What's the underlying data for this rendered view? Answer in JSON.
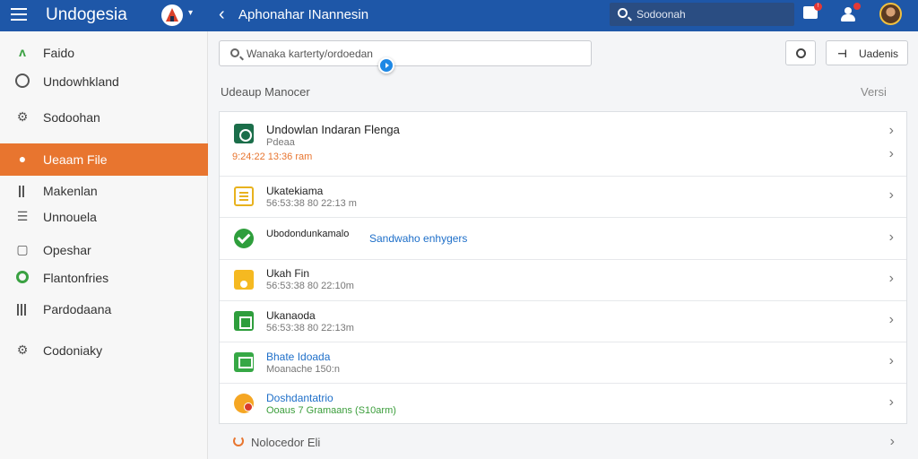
{
  "topbar": {
    "app_title": "Undogesia",
    "logo_caret": "▾",
    "back_arrow": "‹",
    "page_heading": "Aphonahar INannesin",
    "search_placeholder": "Sodoonah",
    "notification_badge": "!"
  },
  "sidebar": {
    "items": [
      {
        "label": "Faido",
        "icon": "a-icon",
        "active": false
      },
      {
        "label": "Undowhkland",
        "icon": "clock-icon",
        "active": false
      },
      {
        "label": "Sodoohan",
        "icon": "gear-icon",
        "active": false
      },
      {
        "label": "Ueaam File",
        "icon": "circle-icon",
        "active": true
      },
      {
        "label": "Makenlan",
        "icon": "bars-icon",
        "active": false
      },
      {
        "label": "Unnouela",
        "icon": "stack-icon",
        "active": false
      },
      {
        "label": "Opeshar",
        "icon": "box-icon",
        "active": false
      },
      {
        "label": "Flantonfries",
        "icon": "ring-icon",
        "active": false
      },
      {
        "label": "Pardodaana",
        "icon": "columns-icon",
        "active": false
      },
      {
        "label": "Codoniaky",
        "icon": "gear-icon",
        "active": false
      }
    ]
  },
  "main": {
    "search_value": "Wanaka karterty/ordoedan",
    "update_label": "Uadenis",
    "section_title": "Udeaup Manocer",
    "section_link": "Versi",
    "rows": [
      {
        "title": "Undowlan Indaran Flenga",
        "subtitle": "Pdeaa",
        "meta": "9:24:22 13:36 ram",
        "mid": "",
        "icon": "green-dark",
        "title_color": "#222"
      },
      {
        "title": "Ukatekiama",
        "subtitle": "56:53:38 80 22:13 m",
        "meta": "",
        "mid": "",
        "icon": "yellow-doc",
        "title_color": "#222"
      },
      {
        "title": "Ubodondunkamalo",
        "subtitle": "",
        "meta": "",
        "mid": "Sandwaho enhygers",
        "icon": "check",
        "title_color": "#222"
      },
      {
        "title": "Ukah Fin",
        "subtitle": "56:53:38 80 22:10m",
        "meta": "",
        "mid": "",
        "icon": "yellow",
        "title_color": "#222"
      },
      {
        "title": "Ukanaoda",
        "subtitle": "56:53:38 80 22:13m",
        "meta": "",
        "mid": "",
        "icon": "green",
        "title_color": "#222"
      },
      {
        "title": "Bhate Idoada",
        "subtitle": "Moanache 150:n",
        "meta": "",
        "mid": "",
        "icon": "green2",
        "title_color": "#1e6fc9"
      },
      {
        "title": "Doshdantatrio",
        "subtitle": "Ooaus 7 Gramaans (S10arm)",
        "meta": "",
        "mid": "",
        "icon": "orange",
        "title_color": "#1e6fc9"
      }
    ],
    "footer_label": "Nolocedor Eli"
  },
  "colors": {
    "topbar": "#1e57a8",
    "active": "#e8752f",
    "link": "#1e6fc9"
  }
}
